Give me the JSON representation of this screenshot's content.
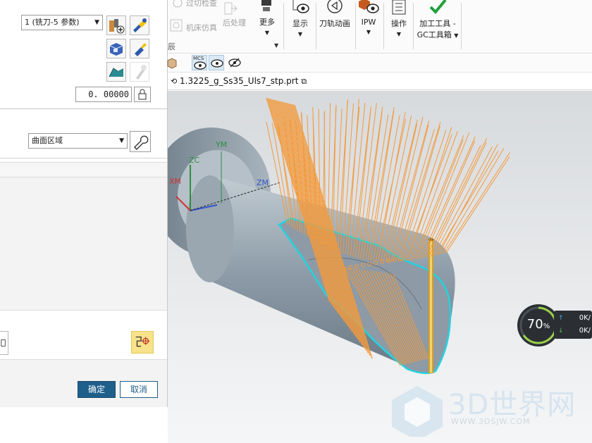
{
  "ribbon": {
    "top_items": [
      {
        "label": "过切检查",
        "enabled": false
      },
      {
        "label": "机床仿真",
        "enabled": false
      },
      {
        "label": "后处理",
        "enabled": false
      }
    ],
    "buttons": [
      {
        "label": "更多"
      },
      {
        "label": "显示"
      },
      {
        "label": "刀轨动画"
      },
      {
        "label": "IPW"
      },
      {
        "label": "操作"
      },
      {
        "label": "加工工具 -",
        "sub_label": "GC工具箱"
      }
    ],
    "left_fragment": "辰"
  },
  "toolbar2": {
    "icons": [
      "box-icon",
      "mcs-show-icon",
      "eye-show-icon",
      "eye-hide-icon"
    ],
    "mcs_label": "MCS"
  },
  "file_tab": {
    "label": "1.3225_g_Ss35_Uls7_stp.prt"
  },
  "dialog": {
    "tool_select": {
      "value": "1 (铣刀-5 参数)"
    },
    "value_field": {
      "value": "0. 00000"
    },
    "region_select": {
      "value": "曲面区域"
    },
    "ok_label": "确定",
    "cancel_label": "取消"
  },
  "viewport": {
    "axis_labels": {
      "zc": "ZC",
      "ym": "YM",
      "zm": "ZM",
      "xm": "XM"
    },
    "gauge": {
      "value": "70",
      "unit": "%"
    },
    "speed": {
      "up": "0K/",
      "down": "0K/"
    },
    "colors": {
      "toolpath": "#f39a3c",
      "boundary": "#22d3e0",
      "part": "#8a9ba8",
      "background_top": "#d9dcdf",
      "background_bottom": "#f4f5f6"
    }
  },
  "watermark": {
    "text": "3D世界网",
    "url": "WWW.3DSJW.COM"
  }
}
